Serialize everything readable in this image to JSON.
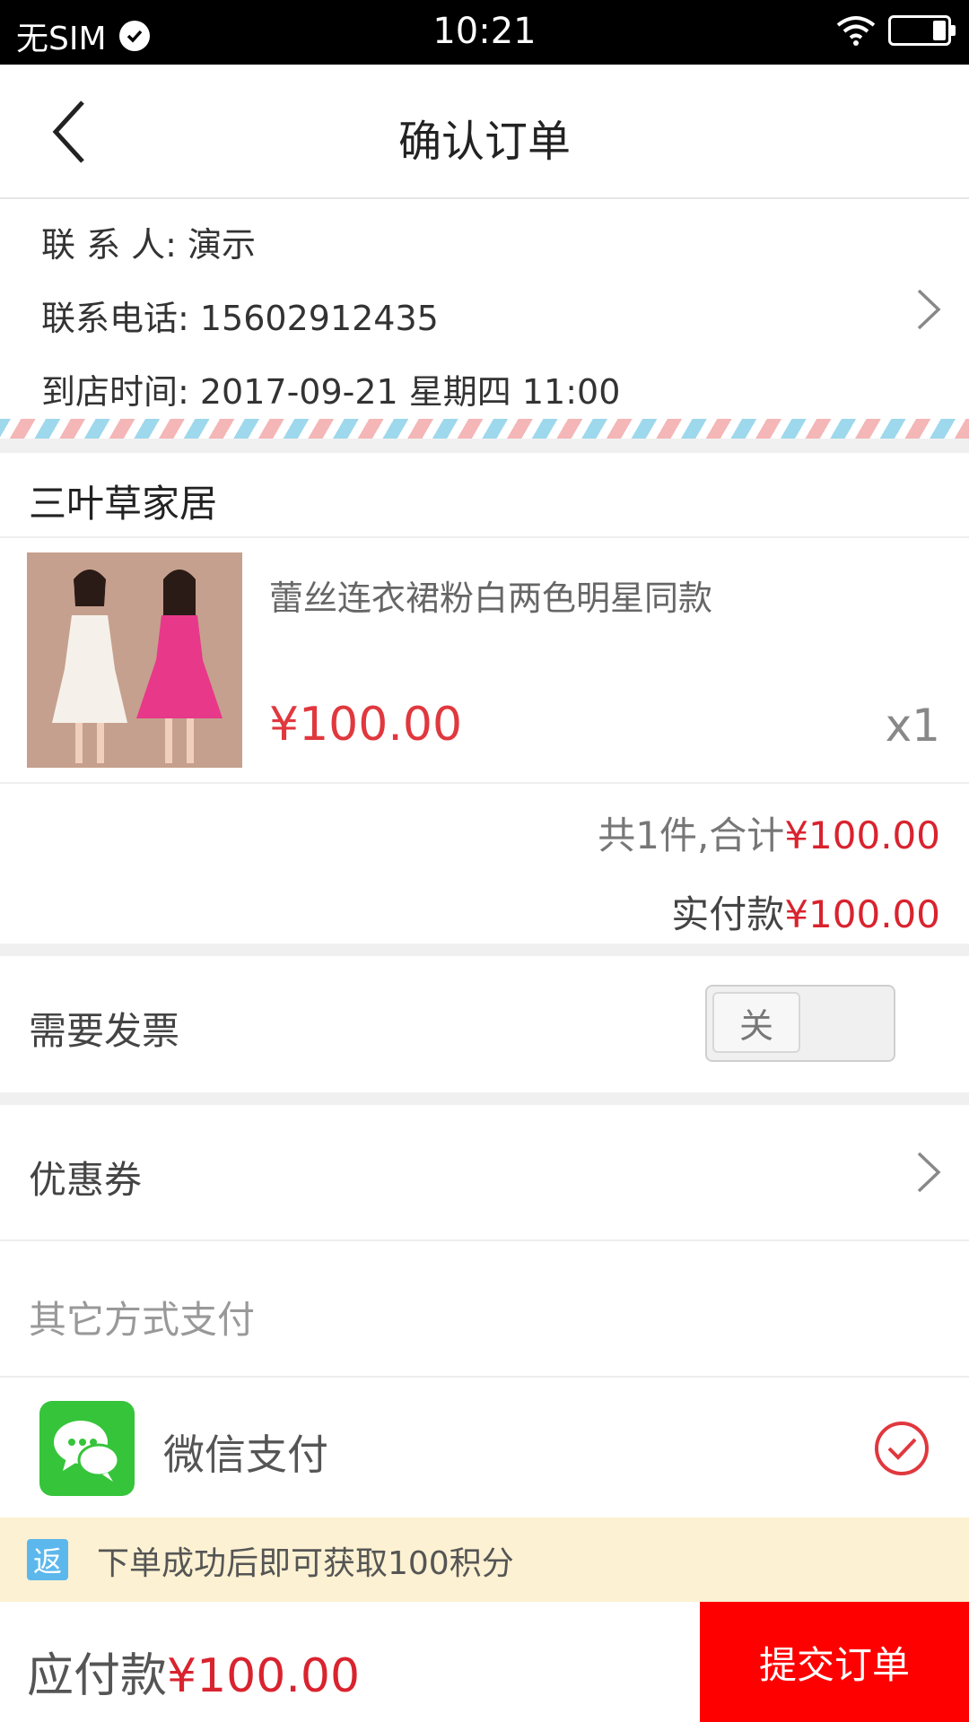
{
  "status_bar": {
    "carrier": "无SIM",
    "time": "10:21"
  },
  "header": {
    "title": "确认订单"
  },
  "contact": {
    "name_row": "联 系 人: 演示",
    "phone_row": "联系电话: 15602912435",
    "time_row": "到店时间: 2017-09-21 星期四 11:00"
  },
  "store": {
    "name": "三叶草家居",
    "product": {
      "title": "蕾丝连衣裙粉白两色明星同款",
      "price": "¥100.00",
      "qty": "x1"
    },
    "summary_prefix": "共1件,合计",
    "summary_total": "¥100.00",
    "paid_label": "实付款",
    "paid_amount": "¥100.00"
  },
  "invoice": {
    "label": "需要发票",
    "toggle_label": "关"
  },
  "coupon": {
    "label": "优惠券"
  },
  "payment": {
    "section_label": "其它方式支付",
    "method_label": "微信支付"
  },
  "notice": {
    "badge": "返",
    "text": "下单成功后即可获取100积分"
  },
  "bottom": {
    "due_label": "应付款",
    "due_amount": "¥100.00",
    "submit_label": "提交订单"
  },
  "colors": {
    "accent_red": "#d9232e",
    "submit_bg": "#ff0000",
    "wechat_green": "#36c43b",
    "notice_bg": "#fcf1d2"
  }
}
